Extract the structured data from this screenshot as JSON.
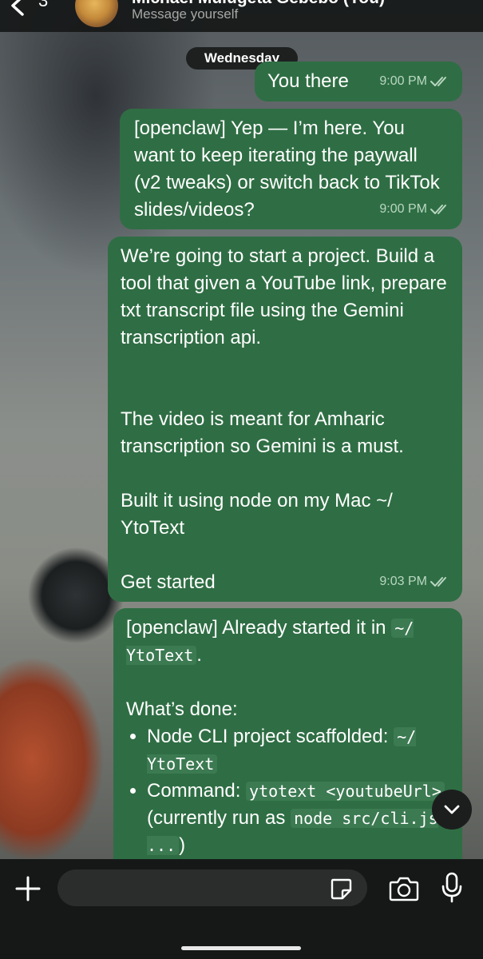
{
  "header": {
    "back_count": "3",
    "chat_name": "Michael Mulugeta Gebebo (You)",
    "subtitle": "Message yourself"
  },
  "date_chip": "Wednesday",
  "messages": [
    {
      "text": "You there",
      "time": "9:00 PM"
    },
    {
      "text": "[openclaw] Yep — I’m here. You want to keep iterating the paywall (v2 tweaks) or switch back to TikTok slides/videos?",
      "time": "9:00 PM"
    },
    {
      "text": "We’re going to start a project. Build a tool that given a YouTube link, prepare txt transcript file using the Gemini transcription api.\n\n\nThe video is meant for Amharic transcription so Gemini is a must.\n\nBuilt it using node on my Mac ~/ YtoText\n\nGet started",
      "time": "9:03 PM"
    },
    {
      "intro_prefix": "[openclaw] Already started it in ",
      "intro_code": "~/ YtoText",
      "intro_suffix": ".",
      "done_heading": "What’s done:",
      "bullets": [
        {
          "prefix": "Node CLI project scaffolded: ",
          "code": "~/ YtoText",
          "mid": "",
          "code2": "",
          "suffix": ""
        },
        {
          "prefix": "Command: ",
          "code": "ytotext <youtubeUrl>",
          "mid": " (currently run as ",
          "code2": "node src/cli.js ...",
          "suffix": ")"
        }
      ]
    }
  ],
  "colors": {
    "bubble": "#2f6e44",
    "header": "#161818",
    "ticks": "#b9d7c2"
  },
  "icons": [
    "chevron-left-icon",
    "double-check-icon",
    "chevron-down-icon",
    "plus-icon",
    "sticker-icon",
    "camera-icon",
    "microphone-icon"
  ],
  "input": {
    "placeholder": ""
  }
}
